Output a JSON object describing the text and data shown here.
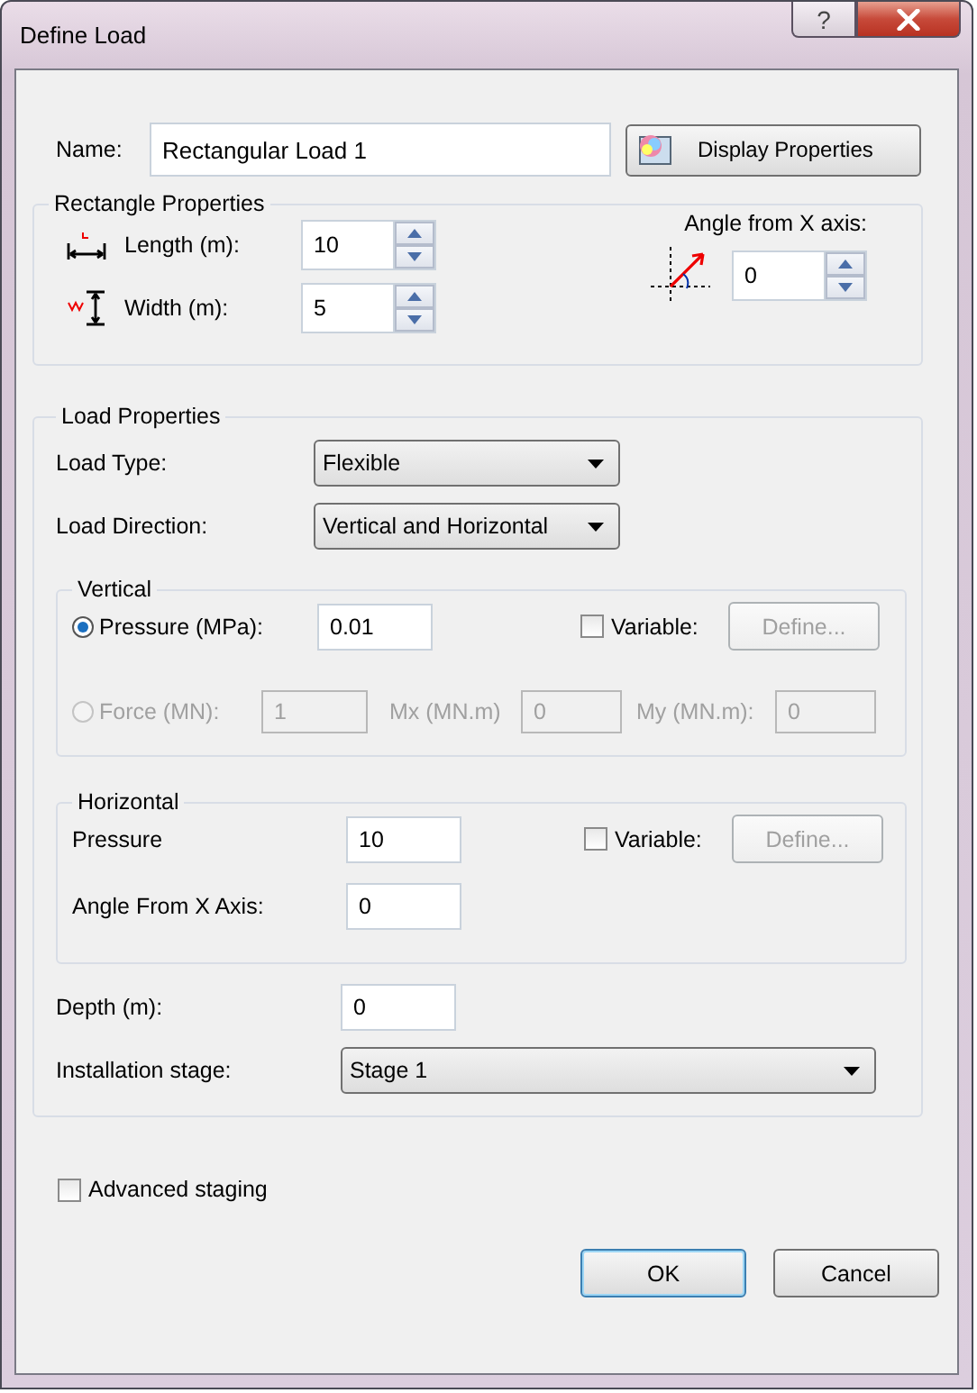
{
  "window": {
    "title": "Define Load",
    "help_button": "?"
  },
  "name": {
    "label": "Name:",
    "value": "Rectangular Load 1"
  },
  "display_button": "Display Properties",
  "rectangle": {
    "title": "Rectangle Properties",
    "length": {
      "label": "Length (m):",
      "value": "10"
    },
    "width": {
      "label": "Width (m):",
      "value": "5"
    },
    "angle": {
      "label": "Angle from X axis:",
      "value": "0"
    }
  },
  "load": {
    "title": "Load Properties",
    "load_type": {
      "label": "Load Type:",
      "value": "Flexible"
    },
    "load_direction": {
      "label": "Load Direction:",
      "value": "Vertical and Horizontal"
    },
    "vertical": {
      "title": "Vertical",
      "pressure": {
        "label": "Pressure (MPa):",
        "value": "0.01",
        "selected": true
      },
      "variable": {
        "label": "Variable:",
        "checked": false
      },
      "define_button": {
        "label": "Define...",
        "disabled": true
      },
      "force": {
        "label": "Force (MN):",
        "value": "1",
        "selected": false,
        "disabled": true
      },
      "mx": {
        "label": "Mx (MN.m)",
        "value": "0",
        "disabled": true
      },
      "my": {
        "label": "My (MN.m):",
        "value": "0",
        "disabled": true
      }
    },
    "horizontal": {
      "title": "Horizontal",
      "pressure": {
        "label": "Pressure",
        "value": "10"
      },
      "variable": {
        "label": "Variable:",
        "checked": false
      },
      "define_button": {
        "label": "Define...",
        "disabled": true
      },
      "angle": {
        "label": "Angle From X Axis:",
        "value": "0"
      }
    },
    "depth": {
      "label": "Depth (m):",
      "value": "0"
    },
    "stage": {
      "label": "Installation stage:",
      "value": "Stage 1"
    }
  },
  "advanced": {
    "label": "Advanced staging",
    "checked": false
  },
  "buttons": [
    {
      "label": "OK",
      "default": true
    },
    {
      "label": "Cancel",
      "default": false
    }
  ]
}
